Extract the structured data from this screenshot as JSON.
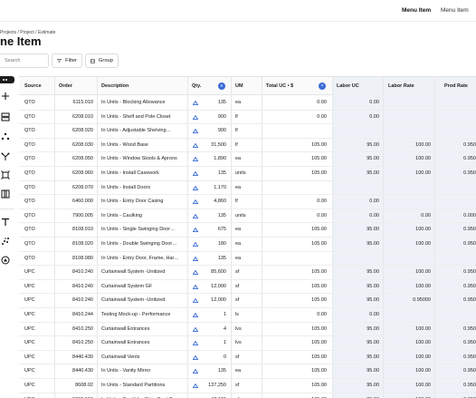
{
  "topnav": {
    "menu_active": "Menu Item",
    "menu_other": "Menu Item"
  },
  "breadcrumb": "Projects / Project / Estimate",
  "page_title": "ne Item",
  "toolbar": {
    "search_placeholder": "Search",
    "filter_label": "Filter",
    "group_label": "Group"
  },
  "columns": [
    "Source",
    "Order",
    "Description",
    "Qty.",
    "UM",
    "Total UC • $",
    "Labor UC",
    "Labor Rate",
    "Prod Rate"
  ],
  "rows": [
    [
      "QTO",
      "6115.010",
      "In Units - Blocking Allowance",
      "135",
      "ea",
      "0.00",
      "0.00",
      "",
      ""
    ],
    [
      "QTO",
      "6208.010",
      "In Units - Shelf and Pole Closet",
      "900",
      "lf",
      "0.00",
      "0.00",
      "",
      ""
    ],
    [
      "QTO",
      "6208.020",
      "In Units - Adjustable Shelving…",
      "900",
      "lf",
      "",
      "",
      "",
      ""
    ],
    [
      "QTO",
      "6208.030",
      "In Units - Wood Base",
      "31,500",
      "lf",
      "105.00",
      "95.00",
      "100.00",
      "0.9500"
    ],
    [
      "QTO",
      "6208.050",
      "In Units - Window Stools & Aprons",
      "1,890",
      "ea",
      "105.00",
      "95.00",
      "100.00",
      "0.9500"
    ],
    [
      "QTO",
      "6208.060",
      "In Units - Install Casework",
      "135",
      "units",
      "105.00",
      "95.00",
      "100.00",
      "0.9500"
    ],
    [
      "QTO",
      "6208.070",
      "In Units - Install Doors",
      "1,170",
      "ea",
      "",
      "",
      "",
      ""
    ],
    [
      "QTO",
      "6460.000",
      "In Units - Entry Door Casing",
      "4,860",
      "lf",
      "0.00",
      "0.00",
      "",
      ""
    ],
    [
      "QTO",
      "7900.005",
      "In Units - Caulking",
      "135",
      "units",
      "0.00",
      "0.00",
      "0.00",
      "0.0000"
    ],
    [
      "QTO",
      "8108.010",
      "In Units - Single Swinging Door…",
      "675",
      "ea",
      "105.00",
      "95.00",
      "100.00",
      "0.9500"
    ],
    [
      "QTO",
      "8108.020",
      "In Units - Double Swinging Door…",
      "180",
      "ea",
      "105.00",
      "95.00",
      "100.00",
      "0.9500"
    ],
    [
      "QTO",
      "8108.080",
      "In Units - Entry Door, Frame, Har…",
      "135",
      "ea",
      "",
      "",
      "",
      ""
    ],
    [
      "UPC",
      "8410.240",
      "Curtainwall System -Unitized",
      "85,600",
      "sf",
      "105.00",
      "95.00",
      "100.00",
      "0.9500"
    ],
    [
      "UPC",
      "8410.240",
      "Curtainwall System GF",
      "12,000",
      "sf",
      "105.00",
      "95.00",
      "100.00",
      "0.9500"
    ],
    [
      "UPC",
      "8410.240",
      "Curtainwall System -Unitized",
      "12,000",
      "sf",
      "105.00",
      "95.00",
      "0.95000",
      "0.9500"
    ],
    [
      "UPC",
      "8410.244",
      "Testing Mock-up - Performance",
      "1",
      "ls",
      "0.00",
      "0.00",
      "",
      ""
    ],
    [
      "UPC",
      "8410.250",
      "Curtainwall Entrances",
      "4",
      "lvs",
      "105.00",
      "95.00",
      "100.00",
      "0.9500"
    ],
    [
      "UPC",
      "8410.250",
      "Curtainwall Entrances",
      "1",
      "lvs",
      "105.00",
      "95.00",
      "100.00",
      "0.9500"
    ],
    [
      "UPC",
      "8440.430",
      "Curtainwall Vents",
      "0",
      "sf",
      "105.00",
      "95.00",
      "100.00",
      "0.9500"
    ],
    [
      "UPC",
      "8440.430",
      "In Units - Vanity Mirror",
      "135",
      "ea",
      "105.00",
      "95.00",
      "100.00",
      "0.9500"
    ],
    [
      "UPC",
      "8608.02",
      "In Units - Standard Partitions",
      "137,250",
      "sf",
      "105.00",
      "95.00",
      "100.00",
      "0.9500"
    ],
    [
      "UPC",
      "9208.010",
      "In Units - Credit for Skim Coat C…",
      "47,121",
      "sf",
      "105.00",
      "95.00",
      "100.00",
      "0.9500"
    ]
  ],
  "colors": {
    "accent": "#3a6bd8",
    "shade": "#eef2f8"
  },
  "icons": [
    "plus-icon",
    "layers-icon",
    "dots-icon",
    "branch-icon",
    "target-icon",
    "columns-icon",
    "text-icon",
    "scatter-icon",
    "alert-icon",
    "triangle-icon",
    "filter-icon",
    "group-icon"
  ]
}
